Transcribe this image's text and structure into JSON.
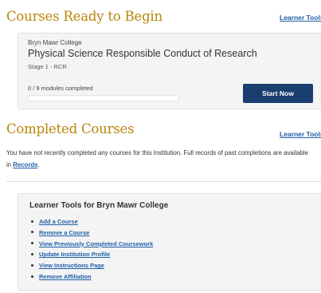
{
  "ready": {
    "heading": "Courses Ready to Begin",
    "learner_tools_link": "Learner Tools",
    "course": {
      "institution": "Bryn Mawr College",
      "title": "Physical Science Responsible Conduct of Research",
      "stage": "Stage 1 - RCR",
      "modules_completed": "0 / 9 modules completed",
      "progress_fraction": 0,
      "start_button": "Start Now"
    }
  },
  "completed": {
    "heading": "Completed Courses",
    "learner_tools_link": "Learner Tools",
    "message_before": "You have not recently completed any courses for this Institution. Full records of past completions are available in ",
    "records_link": "Records",
    "message_after": "."
  },
  "tools": {
    "heading": "Learner Tools for Bryn Mawr College",
    "items": [
      {
        "label": "Add a Course"
      },
      {
        "label": "Remove a Course"
      },
      {
        "label": "View Previously Completed Coursework"
      },
      {
        "label": "Update Institution Profile"
      },
      {
        "label": "View Instructions Page"
      },
      {
        "label": "Remove Affiliation"
      }
    ]
  },
  "colors": {
    "heading": "#b8860b",
    "link": "#1f5fa8",
    "button": "#1a3e6f",
    "card_bg": "#f4f4f4"
  }
}
